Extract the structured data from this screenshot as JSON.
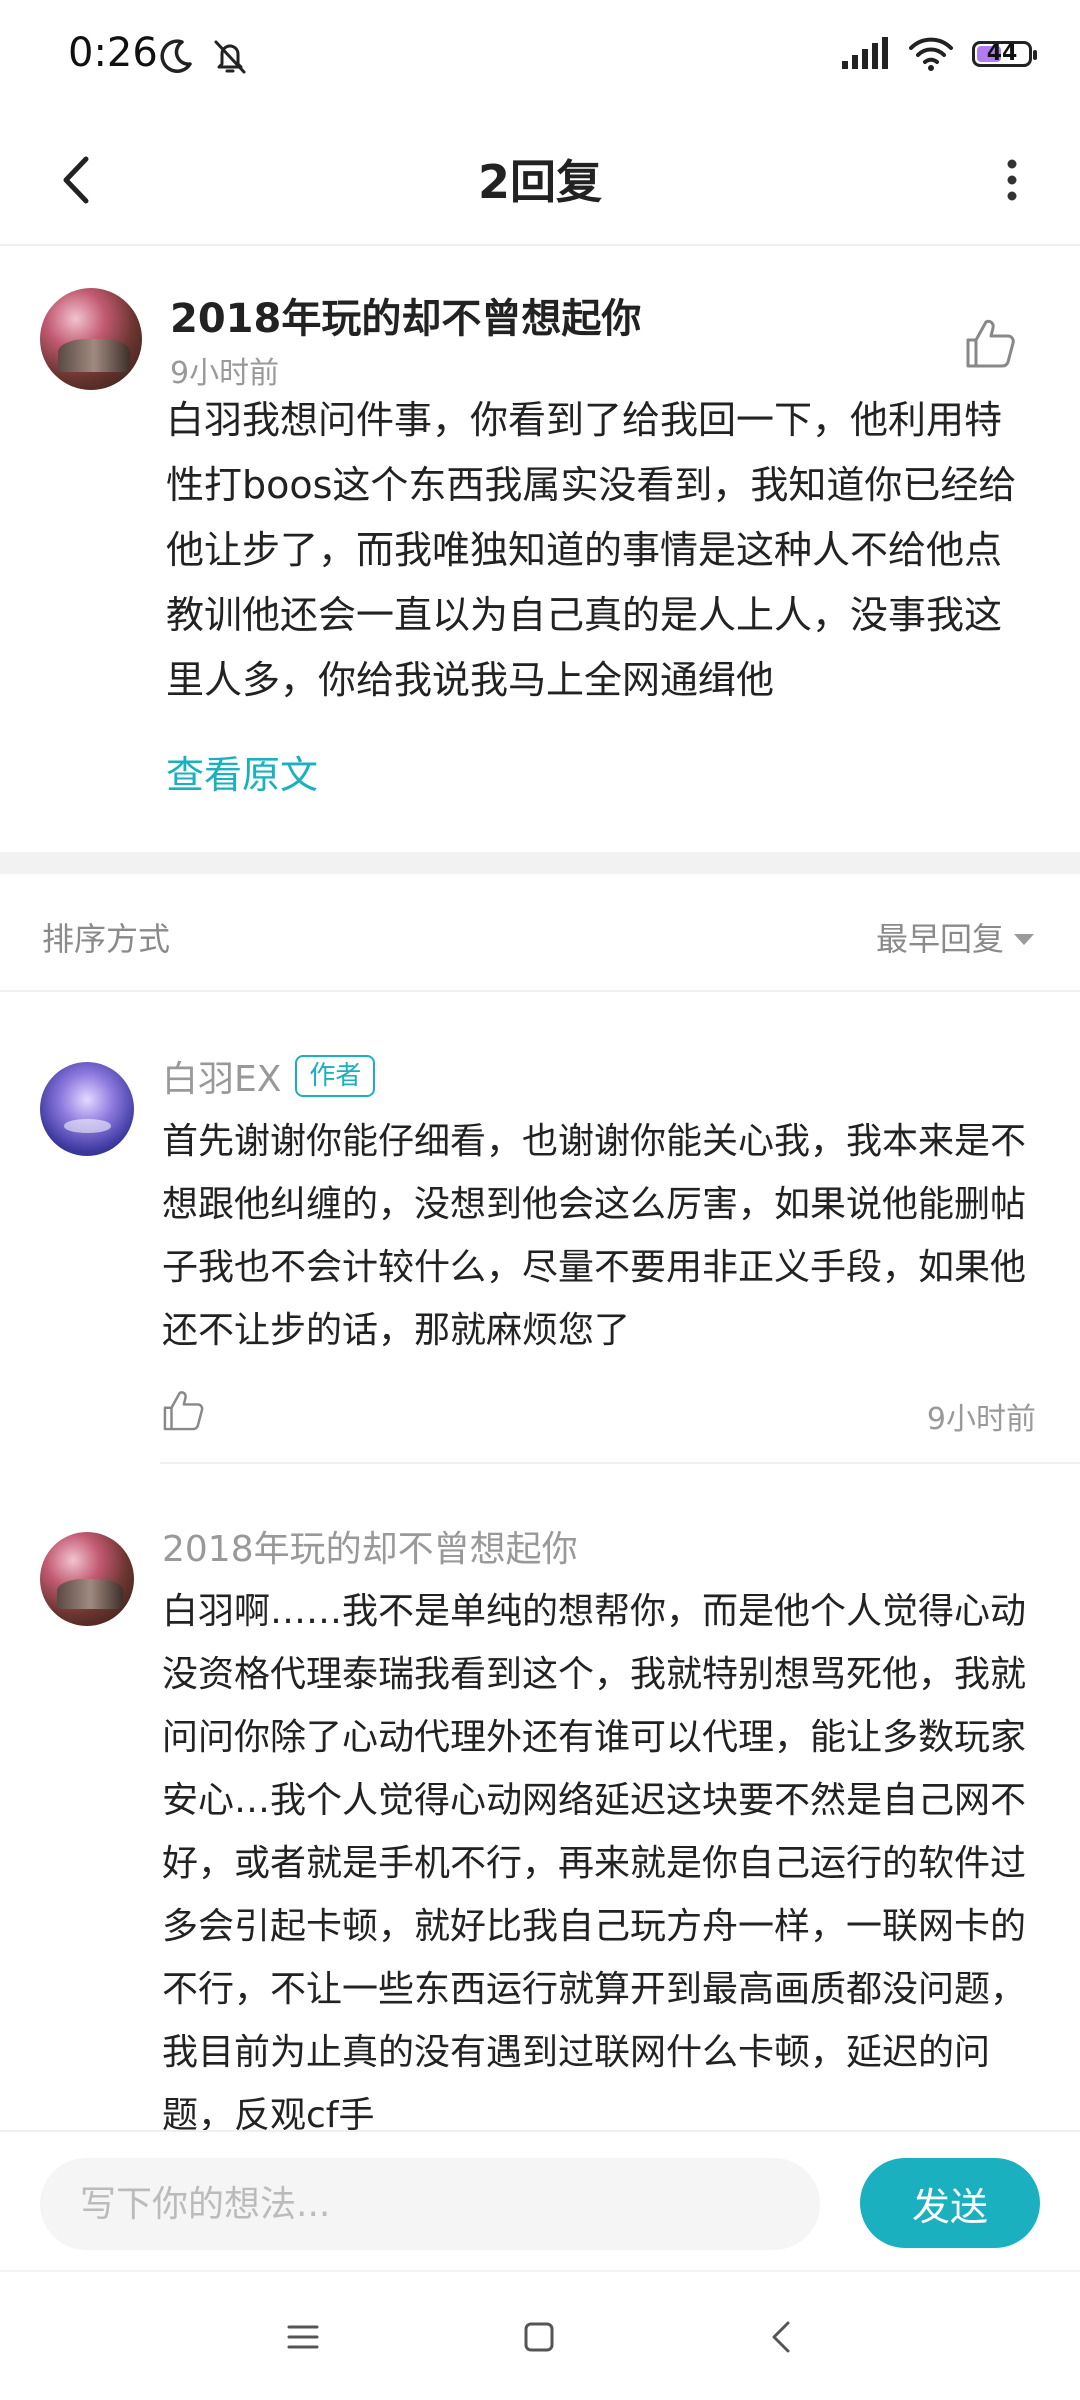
{
  "status_bar": {
    "time": "0:26",
    "icons": [
      "moon-icon",
      "bell-off-icon",
      "signal-icon",
      "wifi-icon",
      "battery-icon"
    ],
    "battery_level": "44"
  },
  "nav": {
    "title": "2回复"
  },
  "main_post": {
    "author": "2018年玩的却不曾想起你",
    "time": "9小时前",
    "content": "白羽我想问件事，你看到了给我回一下，他利用特性打boos这个东西我属实没看到，我知道你已经给他让步了，而我唯独知道的事情是这种人不给他点教训他还会一直以为自己真的是人上人，没事我这里人多，你给我说我马上全网通缉他",
    "view_original": "查看原文"
  },
  "sort": {
    "label": "排序方式",
    "value": "最早回复"
  },
  "replies": [
    {
      "author": "白羽EX",
      "tag": "作者",
      "content": "首先谢谢你能仔细看，也谢谢你能关心我，我本来是不想跟他纠缠的，没想到他会这么厉害，如果说他能删帖子我也不会计较什么，尽量不要用非正义手段，如果他还不让步的话，那就麻烦您了",
      "time": "9小时前"
    },
    {
      "author": "2018年玩的却不曾想起你",
      "content": "白羽啊……我不是单纯的想帮你，而是他个人觉得心动没资格代理泰瑞我看到这个，我就特别想骂死他，我就问问你除了心动代理外还有谁可以代理，能让多数玩家安心…我个人觉得心动网络延迟这块要不然是自己网不好，或者就是手机不行，再来就是你自己运行的软件过多会引起卡顿，就好比我自己玩方舟一样，一联网卡的不行，不让一些东西运行就算开到最高画质都没问题，我目前为止真的没有遇到过联网什么卡顿，延迟的问题，反观cf手"
    }
  ],
  "input": {
    "placeholder": "写下你的想法...",
    "send_label": "发送"
  },
  "colors": {
    "accent": "#1ab0bf",
    "muted_text": "#999999",
    "divider": "#f0f0f0"
  }
}
